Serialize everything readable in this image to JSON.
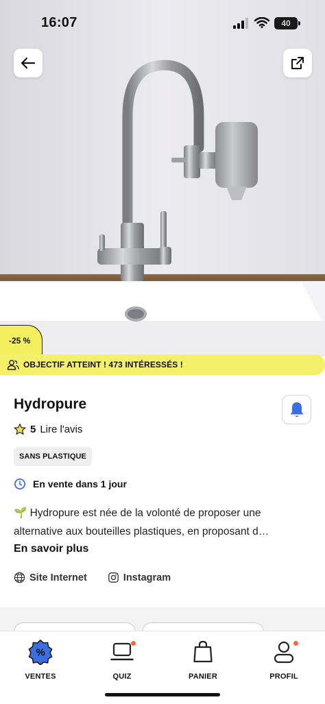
{
  "status_bar": {
    "time": "16:07",
    "battery": "40"
  },
  "hero": {
    "discount_badge": "-25 %"
  },
  "goal_banner": {
    "text": "OBJECTIF ATTEINT ! 473 INTÉRESSÉS !"
  },
  "product": {
    "name": "Hydropure",
    "rating": "5",
    "reviews_link": "Lire l'avis",
    "tag": "SANS PLASTIQUE",
    "sale_info": "En vente dans 1 jour",
    "description_line1": "🌱 Hydropure est née de la volonté de proposer une",
    "description_line2": "alternative aux bouteilles plastiques, en proposant d…",
    "read_more": "En savoir plus",
    "links": {
      "website": "Site Internet",
      "instagram": "Instagram"
    }
  },
  "colors": {
    "accent_yellow": "#f5f06a",
    "notification_dot": "#f06a3c",
    "active_tab": "#3b5bdb"
  },
  "tabbar": {
    "items": [
      {
        "label": "VENTES",
        "icon": "percent-badge-icon",
        "active": true
      },
      {
        "label": "QUIZ",
        "icon": "laptop-icon",
        "notification": true
      },
      {
        "label": "PANIER",
        "icon": "shopping-bag-icon"
      },
      {
        "label": "PROFIL",
        "icon": "user-icon",
        "notification": true
      }
    ]
  }
}
